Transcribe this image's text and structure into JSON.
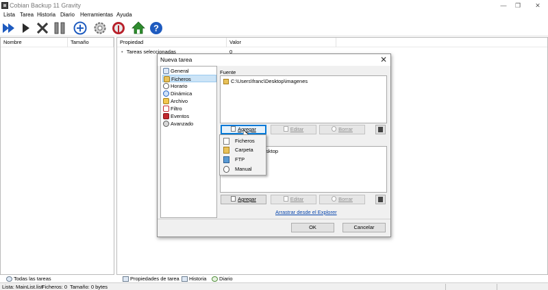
{
  "window": {
    "title": "Cobian Backup 11 Gravity",
    "controls": [
      "—",
      "❐",
      "✕"
    ]
  },
  "menu": [
    "Lista",
    "Tarea",
    "Historia",
    "Diario",
    "Herramientas",
    "Ayuda"
  ],
  "toolbar": {
    "icons": [
      "run-all-icon",
      "run-icon",
      "stop-icon",
      "pause-icon",
      "add-icon",
      "settings-icon",
      "antenna-icon",
      "home-icon",
      "help-icon"
    ]
  },
  "left_pane": {
    "columns": [
      "Nombre",
      "Tamaño"
    ],
    "bottom_tab": "Todas las tareas"
  },
  "right_pane": {
    "columns": [
      "Propiedad",
      "Valor"
    ],
    "rows": [
      {
        "property": "Tareas seleccionadas",
        "value": "0"
      }
    ],
    "bottom_tabs": [
      "Propiedades de tarea",
      "Historia",
      "Diario"
    ]
  },
  "statusbar": {
    "lista": "Lista: MainList.list",
    "ficheros": "Ficheros: 0",
    "tamano": "Tamaño: 0 bytes"
  },
  "dialog": {
    "title": "Nueva tarea",
    "nav": [
      "General",
      "Ficheros",
      "Horario",
      "Dinámica",
      "Archivo",
      "Filtro",
      "Eventos",
      "Avanzado"
    ],
    "nav_selected": "Ficheros",
    "source_label": "Fuente",
    "source_items": [
      "C:\\Users\\franc\\Desktop\\imagenes"
    ],
    "destination_items_partial": "esktop",
    "buttons": {
      "add": "Agregar",
      "edit": "Editar",
      "delete": "Borrar"
    },
    "drag_link": "Arrastrar desde el Explorer",
    "ok": "OK",
    "cancel": "Cancelar",
    "popup_menu": [
      "Ficheros",
      "Carpeta",
      "FTP",
      "Manual"
    ]
  },
  "colors": {
    "accent_blue": "#1e5bbf",
    "selection": "#cce4f7",
    "link": "#0645ad"
  }
}
